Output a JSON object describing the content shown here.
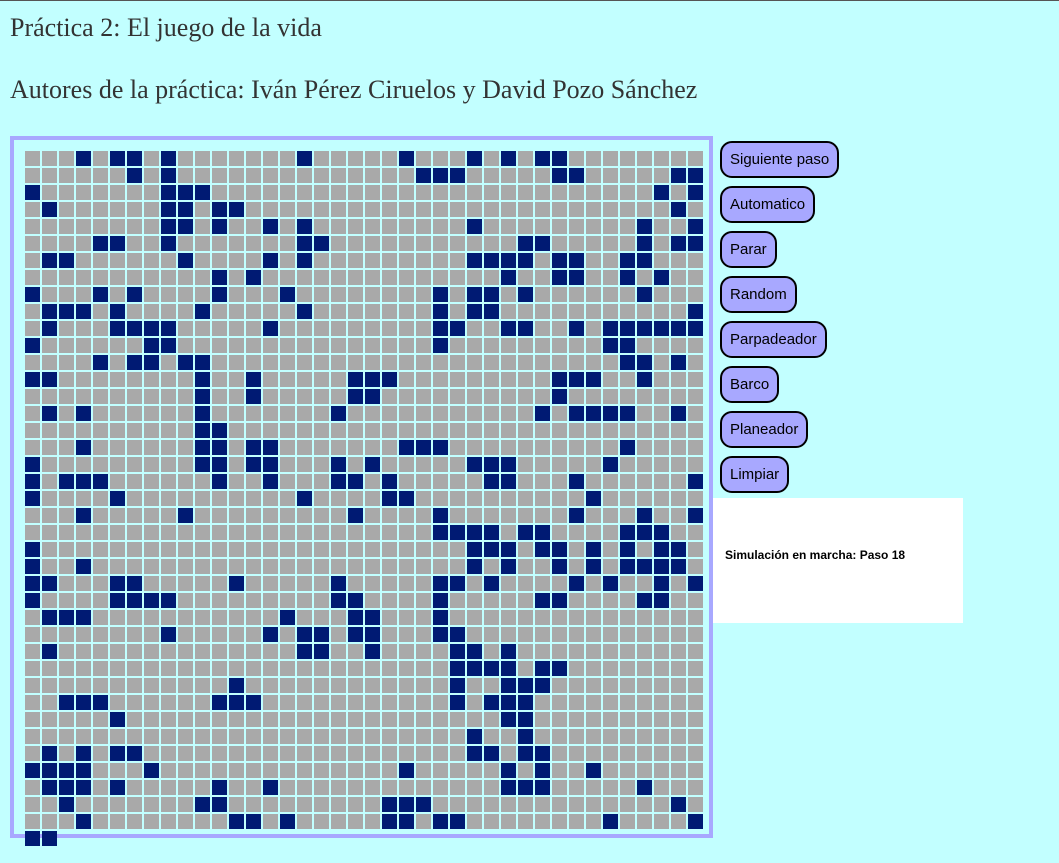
{
  "page": {
    "title": "Práctica 2: El juego de la vida",
    "authors": "Autores de la práctica: Iván Pérez Ciruelos y David Pozo Sánchez"
  },
  "colors": {
    "background": "#c2ffff",
    "board_border": "#a8a8ff",
    "dead_cell": "#a9a9a9",
    "alive_cell": "#001a73",
    "button": "#a8a8ff"
  },
  "buttons": {
    "next_step": "Siguiente paso",
    "automatic": "Automatico",
    "stop": "Parar",
    "random": "Random",
    "blinker": "Parpadeador",
    "boat": "Barco",
    "glider": "Planeador",
    "clear": "Limpiar"
  },
  "status": {
    "message": "Simulación en marcha: Paso 18"
  },
  "board": {
    "rows": 40,
    "cols": 40,
    "cells": [
      "...#.##.#.......#.....#...#.#.##........",
      "......#.#..............###.....##.....##",
      "#.......###..........................#.#",
      ".#......##.##.........................#.",
      "........##.#..#.#.........#.........#..#",
      "....##..#.......##...........##.....#.##",
      ".##......#....#.#.........####.##..##...",
      "...........#.#..............#..##..#.#..",
      "#...#.#....#...#........#.##.#......#...",
      ".###.#....#.....#.......#.##...........#",
      ".#...####.....#.........##..##..#.#######",
      "......##...............#.........##.....",
      "...#.##.##........................##.#.##",
      "........#..#.....###.........###..#.....",
      "........#..#.....##..........#.........#",
      ".#......#.......#...........#.####..#...",
      "........##..............................",
      ".#......##.##.......###..........#....#.",
      "........##.##...#.#.....###.....#.....#.",
      "###......#..#...##.#.....##...#......##.",
      "...#..........#....##..........#........",
      ".#.....#.........#....#.......#...#..#..",
      "......................####.##....###..#.",
      "........................###.##.#.#.##.#.",
      ".#......................#.#..#.#.####.##",
      "...##.....#.....#.....##.#....#.#..#.##.",
      "...####.........##....#.....##....##...#",
      "##...........#...##...#.................",
      "......#.....#.##.##...##...............#",
      "..............##..#....##.#.............",
      ".......................####.##..........",
      "..........#............#..###...........",
      "###......###...........#.###............",
      "...#......................##............",
      "........................#..#...........#",
      ".#.##...................##.##.........##",
      "##...#..............#.....#.#..#.......#",
      "##.#.....#..#.............###.....#.....",
      "#.......##.........###..............#...",
      ".#........##.#.....##.##........#....###"
    ]
  }
}
